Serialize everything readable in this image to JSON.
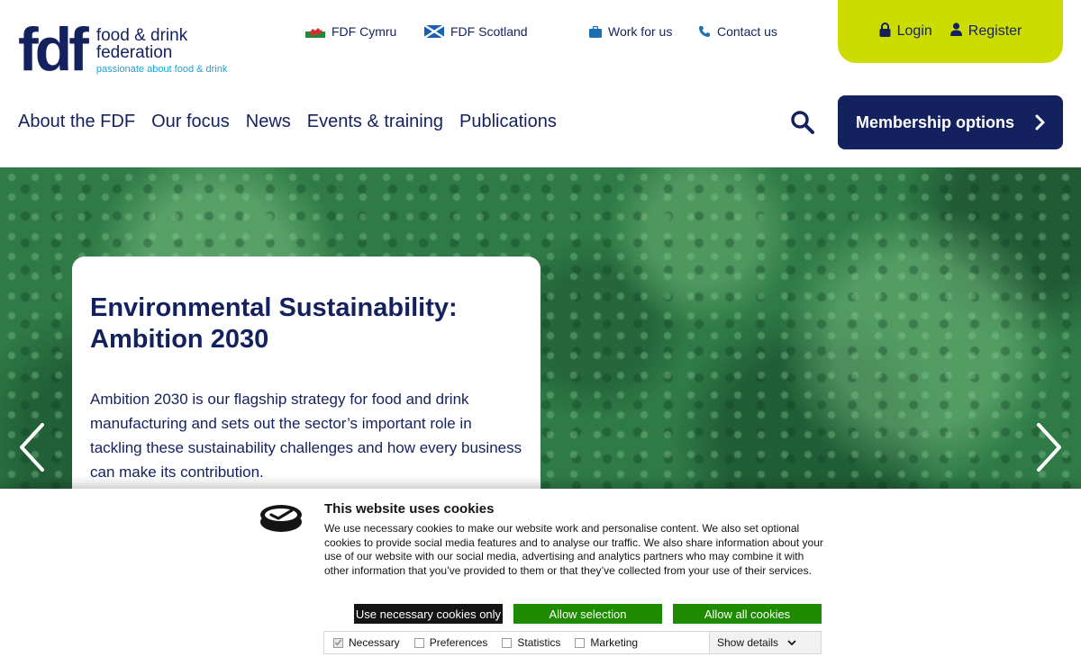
{
  "logo": {
    "mark": "fdf",
    "line1": "food & drink",
    "line2": "federation",
    "tagline": "passionate about food & drink"
  },
  "utility": {
    "cymru": "FDF Cymru",
    "scotland": "FDF Scotland",
    "work": "Work for us",
    "contact": "Contact us"
  },
  "auth": {
    "login": "Login",
    "register": "Register"
  },
  "nav": [
    "About the FDF",
    "Our focus",
    "News",
    "Events & training",
    "Publications"
  ],
  "membership": "Membership options",
  "hero": {
    "title_line1": "Environmental Sustainability:",
    "title_line2": "Ambition 2030",
    "body": "Ambition 2030 is our flagship strategy for food and drink manufacturing and sets out the sector’s important role in tackling these sustainability challenges and how every business can make its contribution."
  },
  "cookies": {
    "title": "This website uses cookies",
    "text": "We use necessary cookies to make our website work and personalise content. We also set optional cookies to provide social media features and to analyse our traffic. We also share information about your use of our website with our social media, advertising and analytics partners who may combine it with other information that you’ve provided to them or that they’ve collected from your use of their services.",
    "buttons": {
      "necessary": "Use necessary cookies only",
      "selection": "Allow selection",
      "all": "Allow all cookies"
    },
    "prefs": {
      "necessary": "Necessary",
      "preferences": "Preferences",
      "statistics": "Statistics",
      "marketing": "Marketing"
    },
    "details": "Show details"
  },
  "colors": {
    "navy": "#14215f",
    "lime": "#cddc00",
    "cyan": "#1aa3d8",
    "cookie_green": "#1d8a00",
    "cookie_dark": "#141414"
  }
}
